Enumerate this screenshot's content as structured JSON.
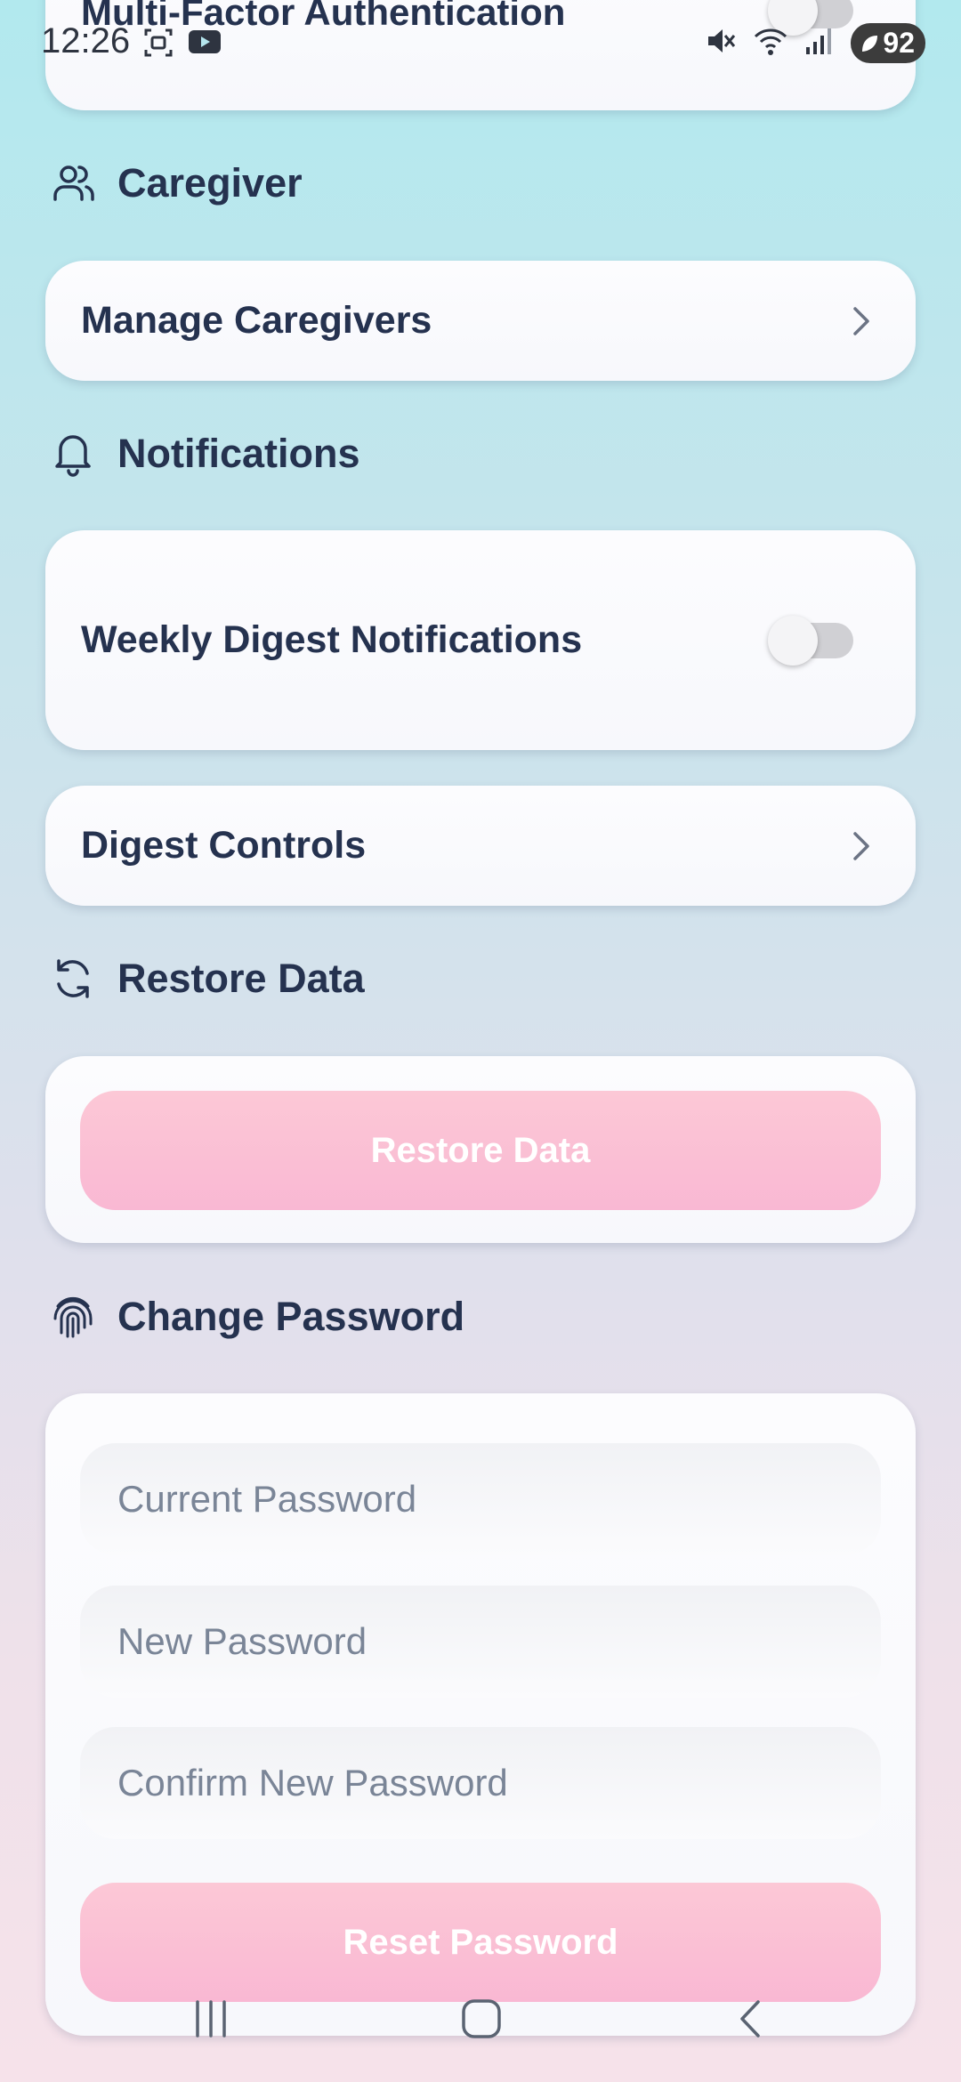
{
  "status_bar": {
    "time": "12:26",
    "battery": "92"
  },
  "mfa": {
    "label": "Multi-Factor Authentication",
    "enabled": false
  },
  "caregiver": {
    "section_title": "Caregiver",
    "manage_label": "Manage Caregivers"
  },
  "notifications": {
    "section_title": "Notifications",
    "weekly_digest_label": "Weekly Digest Notifications",
    "weekly_digest_enabled": false,
    "digest_controls_label": "Digest Controls"
  },
  "restore": {
    "section_title": "Restore Data",
    "button_label": "Restore Data"
  },
  "change_password": {
    "section_title": "Change Password",
    "current_placeholder": "Current Password",
    "new_placeholder": "New Password",
    "confirm_placeholder": "Confirm New Password",
    "reset_label": "Reset Password"
  },
  "colors": {
    "accent_pink": "#f9b8d3",
    "heading": "#25324f",
    "placeholder": "#7a8597"
  }
}
